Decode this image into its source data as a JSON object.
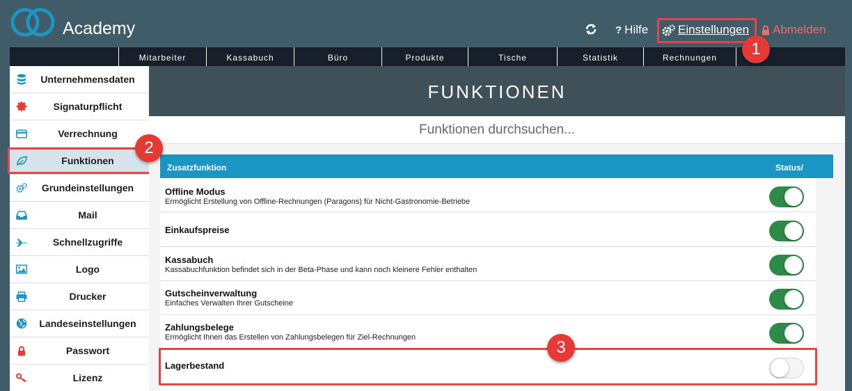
{
  "header": {
    "brand": "Academy",
    "help": "Hilfe",
    "settings": "Einstellungen",
    "logout": "Abmelden"
  },
  "badges": [
    "1",
    "2",
    "3"
  ],
  "topnav": [
    "Mitarbeiter",
    "Kassabuch",
    "Büro",
    "Produkte",
    "Tische",
    "Statistik",
    "Rechnungen"
  ],
  "sidebar": [
    {
      "label": "Unternehmensdaten",
      "icon": "database-icon",
      "color": "#1a95c4"
    },
    {
      "label": "Signaturpflicht",
      "icon": "seal-icon",
      "color": "#e53935"
    },
    {
      "label": "Verrechnung",
      "icon": "credit-card-icon",
      "color": "#1a95c4"
    },
    {
      "label": "Funktionen",
      "icon": "leaf-icon",
      "color": "#1a95c4"
    },
    {
      "label": "Grundeinstellungen",
      "icon": "gears-icon",
      "color": "#1a95c4"
    },
    {
      "label": "Mail",
      "icon": "inbox-icon",
      "color": "#1a95c4"
    },
    {
      "label": "Schnellzugriffe",
      "icon": "plane-icon",
      "color": "#1a95c4"
    },
    {
      "label": "Logo",
      "icon": "image-icon",
      "color": "#1a95c4"
    },
    {
      "label": "Drucker",
      "icon": "printer-icon",
      "color": "#1a95c4"
    },
    {
      "label": "Landeseinstellungen",
      "icon": "globe-icon",
      "color": "#1a95c4"
    },
    {
      "label": "Passwort",
      "icon": "lock-icon",
      "color": "#e53935"
    },
    {
      "label": "Lizenz",
      "icon": "key-icon",
      "color": "#e53935"
    }
  ],
  "content": {
    "title": "FUNKTIONEN",
    "search_placeholder": "Funktionen durchsuchen..."
  },
  "table": {
    "col_feature": "Zusatzfunktion",
    "col_status": "Status/",
    "rows": [
      {
        "name": "Offline Modus",
        "desc": "Ermöglicht Erstellung von Offline-Rechnungen (Paragons) für Nicht-Gastronomie-Betriebe",
        "enabled": true
      },
      {
        "name": "Einkaufspreise",
        "desc": "",
        "enabled": true
      },
      {
        "name": "Kassabuch",
        "desc": "Kassabuchfunktion befindet sich in der Beta-Phase und kann noch kleinere Fehler enthalten",
        "enabled": true
      },
      {
        "name": "Gutscheinverwaltung",
        "desc": "Einfaches Verwalten Ihrer Gutscheine",
        "enabled": true
      },
      {
        "name": "Zahlungsbelege",
        "desc": "Ermöglicht Ihnen das Erstellen von Zahlungsbelegen für Ziel-Rechnungen",
        "enabled": true
      },
      {
        "name": "Lagerbestand",
        "desc": "",
        "enabled": false
      }
    ]
  },
  "colors": {
    "accent": "#1a95c4",
    "toggle_on": "#2e8b47",
    "highlight": "#e64545",
    "logout": "#f26b6b"
  }
}
